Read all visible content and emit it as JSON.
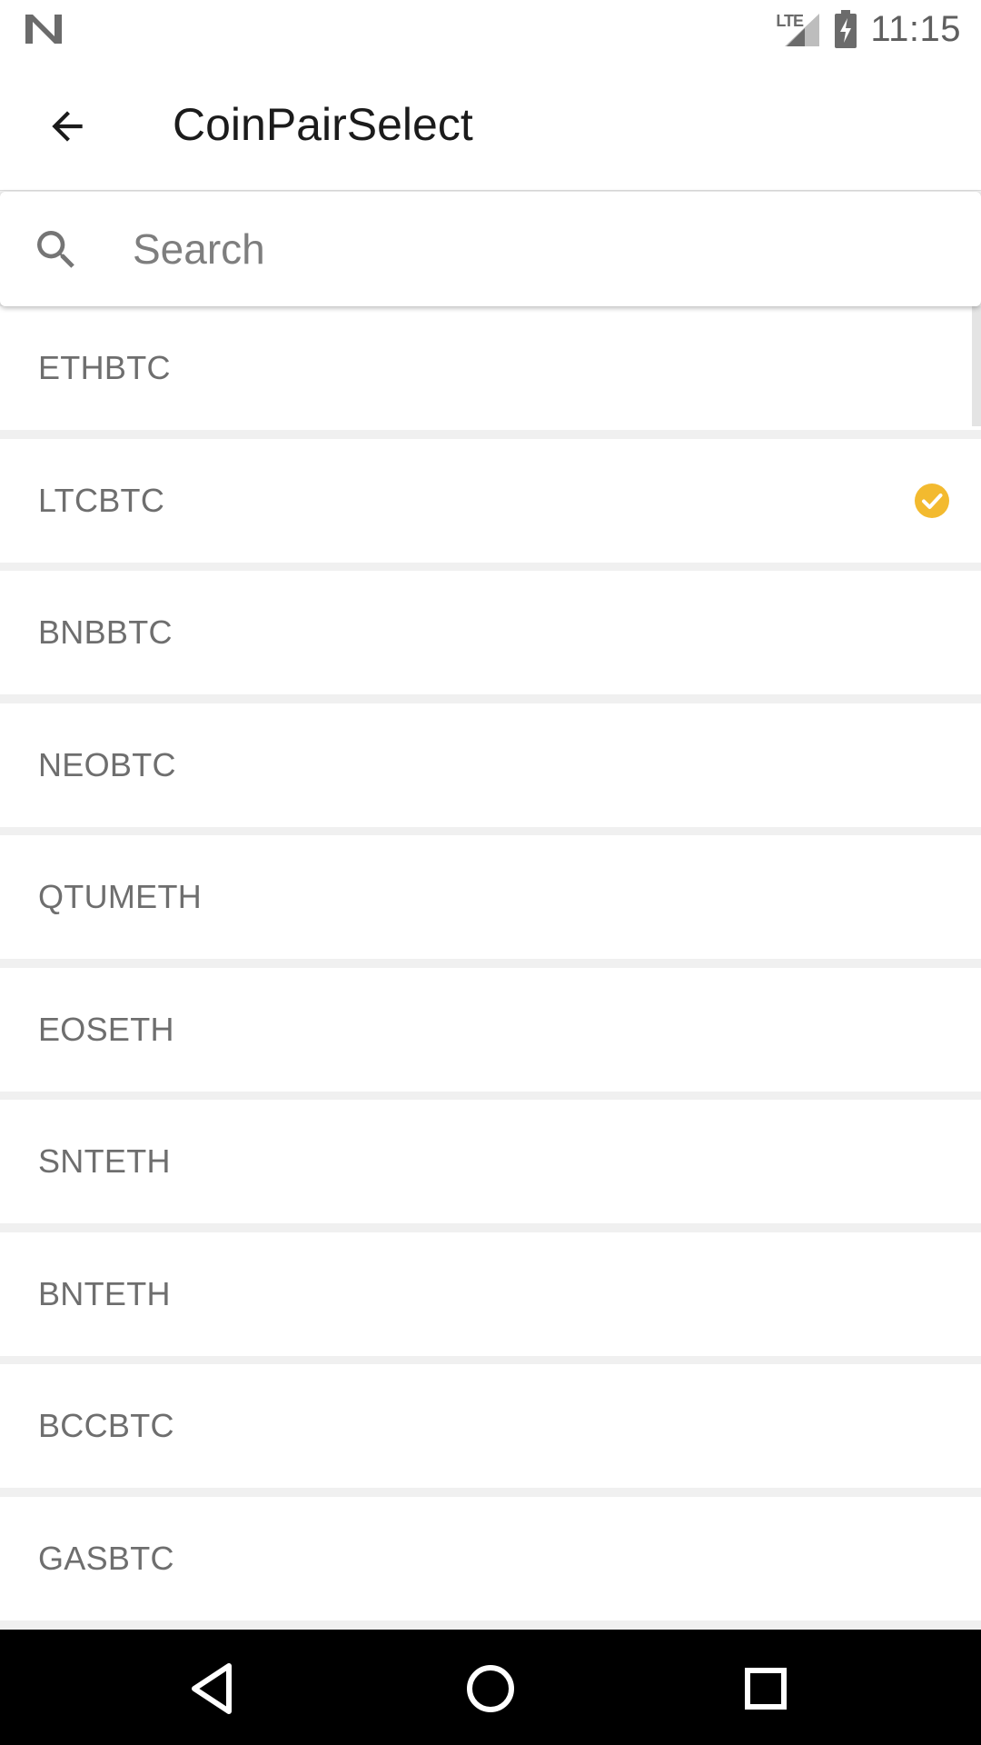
{
  "status_bar": {
    "network": "LTE",
    "time": "11:15",
    "icons": [
      "notification-n-icon",
      "lte-signal-icon",
      "battery-charging-icon"
    ]
  },
  "app_bar": {
    "title": "CoinPairSelect",
    "back_icon": "arrow-back-icon"
  },
  "search": {
    "placeholder": "Search",
    "value": "",
    "icon": "search-icon"
  },
  "pairs": [
    {
      "label": "ETHBTC",
      "selected": false
    },
    {
      "label": "LTCBTC",
      "selected": true
    },
    {
      "label": "BNBBTC",
      "selected": false
    },
    {
      "label": "NEOBTC",
      "selected": false
    },
    {
      "label": "QTUMETH",
      "selected": false
    },
    {
      "label": "EOSETH",
      "selected": false
    },
    {
      "label": "SNTETH",
      "selected": false
    },
    {
      "label": "BNTETH",
      "selected": false
    },
    {
      "label": "BCCBTC",
      "selected": false
    },
    {
      "label": "GASBTC",
      "selected": false
    }
  ],
  "colors": {
    "accent": "#F3BA2F",
    "text_secondary": "#6E6E6E",
    "divider": "#F0F0F0"
  },
  "nav_bar": {
    "buttons": [
      "back-triangle-icon",
      "home-circle-icon",
      "recents-square-icon"
    ]
  }
}
